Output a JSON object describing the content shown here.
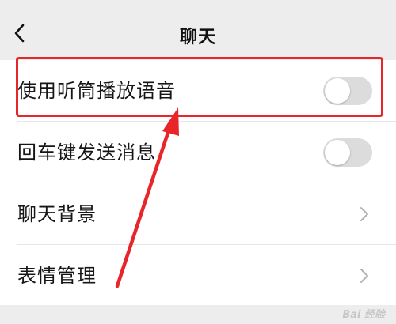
{
  "header": {
    "title": "聊天"
  },
  "settings": {
    "items": [
      {
        "label": "使用听筒播放语音",
        "control": "toggle",
        "enabled": false
      },
      {
        "label": "回车键发送消息",
        "control": "toggle",
        "enabled": false
      },
      {
        "label": "聊天背景",
        "control": "chevron"
      },
      {
        "label": "表情管理",
        "control": "chevron"
      }
    ]
  },
  "annotation": {
    "highlight_color": "#e8262a"
  },
  "watermark": "Bai 经验"
}
